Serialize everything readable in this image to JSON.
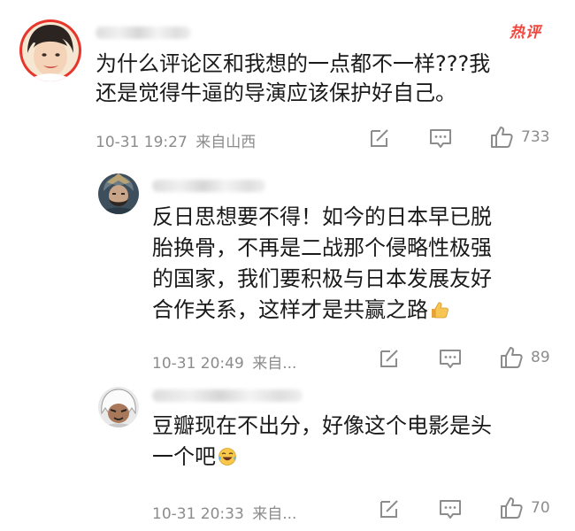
{
  "main_comment": {
    "hot_label": "热评",
    "text_line1": "为什么评论区和我想的一点都不一样???我",
    "text_line2": "还是觉得牛逼的导演应该保护好自己。",
    "timestamp": "10-31 19:27",
    "location": "来自山西",
    "likes": "733",
    "avatar_icon": "avatar-woman-icon"
  },
  "replies": [
    {
      "text_line1": "反日思想要不得！如今的日本早已脱",
      "text_line2": "胎换骨，不再是二战那个侵略性极强",
      "text_line3": "的国家，我们要积极与日本发展友好",
      "text_line4": "合作关系，这样才是共赢之路",
      "emoji_icon": "thumbs-up-emoji-icon",
      "timestamp": "10-31 20:49",
      "location": "来自...",
      "likes": "89",
      "avatar_icon": "avatar-warrior-icon"
    },
    {
      "text_line1": "豆瓣现在不出分，好像这个电影是头",
      "text_line2": "一个吧",
      "emoji_icon": "laughing-tears-emoji-icon",
      "timestamp": "10-31 20:33",
      "location": "来自...",
      "likes": "70",
      "avatar_icon": "avatar-anime-white-hair-icon"
    }
  ],
  "colors": {
    "hot_label": "#f2453d",
    "meta_text": "#8c8c8c",
    "body_text": "#1a1a1a",
    "background": "#ffffff"
  },
  "icons": {
    "repost": "repost-icon",
    "comment": "comment-icon",
    "like": "like-icon"
  }
}
